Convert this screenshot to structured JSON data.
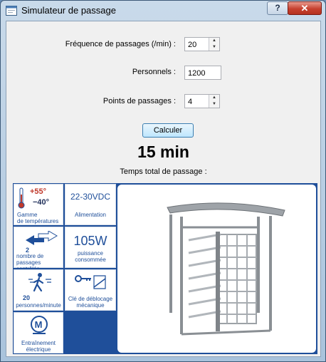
{
  "window": {
    "title": "Simulateur de passage",
    "help_label": "?",
    "close_label": "✕"
  },
  "form": {
    "frequency_label": "Fréquence de passages (/min) :",
    "frequency_value": "20",
    "personnel_label": "Personnels :",
    "personnel_value": "1200",
    "points_label": "Points de passages :",
    "points_value": "4"
  },
  "calculate_label": "Calculer",
  "result_value": "15 min",
  "result_caption": "Temps total de passage :",
  "features": {
    "temp_hot": "+55°",
    "temp_cold": "−40°",
    "temp_caption_1": "Gamme",
    "temp_caption_2": "de températures",
    "power_supply_value": "22-30VDC",
    "power_supply_caption": "Alimentation",
    "controlled_count": "2",
    "controlled_caption_1": "nombre de",
    "controlled_caption_2": "passages contrôlés",
    "power_value": "105W",
    "power_caption_1": "puissance",
    "power_caption_2": "consommée",
    "throughput_value": "20",
    "throughput_caption": "personnes/minute",
    "key_caption_1": "Clé de déblocage",
    "key_caption_2": "mécanique",
    "motor_letter": "M",
    "motor_caption_1": "Entraînement",
    "motor_caption_2": "électrique"
  }
}
